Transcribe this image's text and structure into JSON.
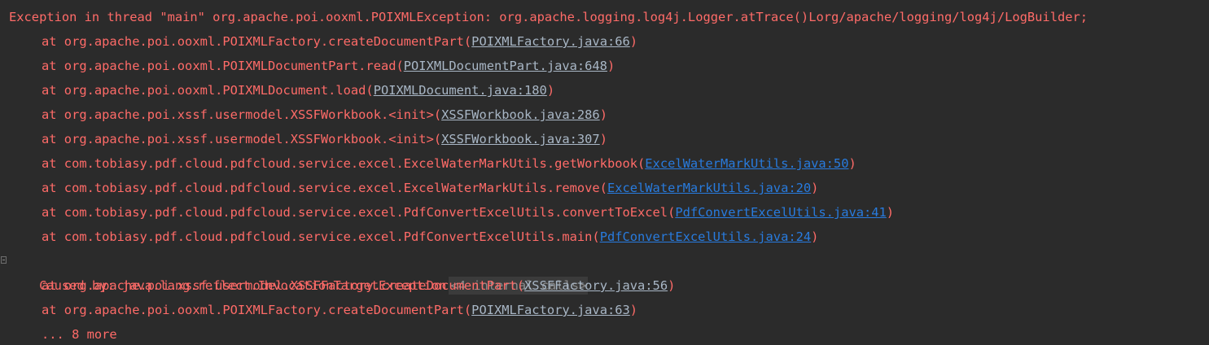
{
  "colors": {
    "background": "#2b2b2b",
    "error_text": "#ff6b68",
    "library_link": "#a9b7c6",
    "project_link": "#287bde",
    "folded_text": "#8c8c8c"
  },
  "exception": {
    "header": "Exception in thread \"main\" org.apache.poi.ooxml.POIXMLException: org.apache.logging.log4j.Logger.atTrace()Lorg/apache/logging/log4j/LogBuilder;",
    "frames": [
      {
        "method": "at org.apache.poi.ooxml.POIXMLFactory.createDocumentPart(",
        "link": "POIXMLFactory.java:66",
        "close": ")"
      },
      {
        "method": "at org.apache.poi.ooxml.POIXMLDocumentPart.read(",
        "link": "POIXMLDocumentPart.java:648",
        "close": ")"
      },
      {
        "method": "at org.apache.poi.ooxml.POIXMLDocument.load(",
        "link": "POIXMLDocument.java:180",
        "close": ")"
      },
      {
        "method": "at org.apache.poi.xssf.usermodel.XSSFWorkbook.<init>(",
        "link": "XSSFWorkbook.java:286",
        "close": ")"
      },
      {
        "method": "at org.apache.poi.xssf.usermodel.XSSFWorkbook.<init>(",
        "link": "XSSFWorkbook.java:307",
        "close": ")"
      },
      {
        "method": "at com.tobiasy.pdf.cloud.pdfcloud.service.excel.ExcelWaterMarkUtils.getWorkbook(",
        "link": "ExcelWaterMarkUtils.java:50",
        "close": ")"
      },
      {
        "method": "at com.tobiasy.pdf.cloud.pdfcloud.service.excel.ExcelWaterMarkUtils.remove(",
        "link": "ExcelWaterMarkUtils.java:20",
        "close": ")"
      },
      {
        "method": "at com.tobiasy.pdf.cloud.pdfcloud.service.excel.PdfConvertExcelUtils.convertToExcel(",
        "link": "PdfConvertExcelUtils.java:41",
        "close": ")"
      },
      {
        "method": "at com.tobiasy.pdf.cloud.pdfcloud.service.excel.PdfConvertExcelUtils.main(",
        "link": "PdfConvertExcelUtils.java:24",
        "close": ")"
      }
    ],
    "caused_by": {
      "label": "Caused by: java.lang.reflect.InvocationTargetException",
      "folded": "<4 internal calls>",
      "frames": [
        {
          "method": "at org.apache.poi.xssf.usermodel.XSSFFactory.createDocumentPart(",
          "link": "XSSFFactory.java:56",
          "close": ")"
        },
        {
          "method": "at org.apache.poi.ooxml.POIXMLFactory.createDocumentPart(",
          "link": "POIXMLFactory.java:63",
          "close": ")"
        }
      ],
      "more": "... 8 more"
    }
  }
}
